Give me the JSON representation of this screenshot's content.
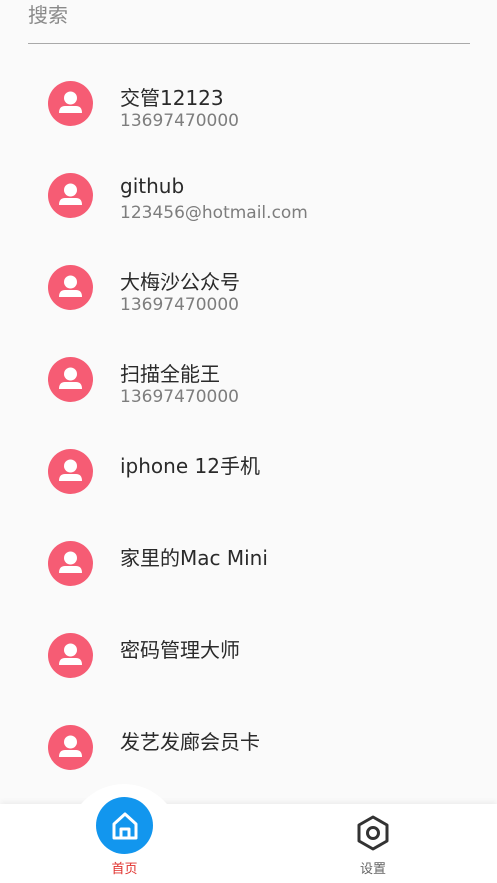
{
  "search": {
    "placeholder": "搜索"
  },
  "items": [
    {
      "title": "交管12123",
      "subtitle": "13697470000"
    },
    {
      "title": "github",
      "subtitle": "123456@hotmail.com"
    },
    {
      "title": "大梅沙公众号",
      "subtitle": "13697470000"
    },
    {
      "title": "扫描全能王",
      "subtitle": "13697470000"
    },
    {
      "title": "iphone 12手机",
      "subtitle": ""
    },
    {
      "title": "家里的Mac Mini",
      "subtitle": ""
    },
    {
      "title": "密码管理大师",
      "subtitle": ""
    },
    {
      "title": "发艺发廊会员卡",
      "subtitle": ""
    }
  ],
  "tabs": {
    "home": {
      "label": "首页",
      "icon": "home-icon",
      "active": true
    },
    "settings": {
      "label": "设置",
      "icon": "settings-icon",
      "active": false
    }
  },
  "colors": {
    "avatar": "#f65c74",
    "home_active": "#1296ee",
    "active_label": "#e0302c"
  }
}
